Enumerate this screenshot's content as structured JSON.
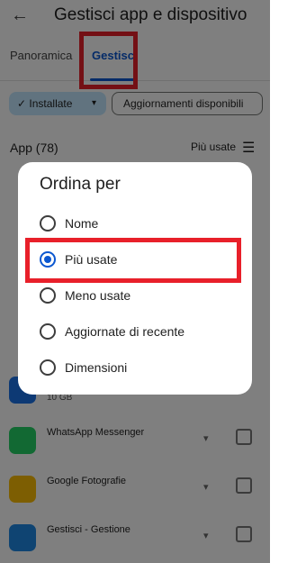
{
  "topbar": {
    "back_icon": "arrow-left-icon",
    "title": "Gestisci app e dispositivo"
  },
  "tabs": [
    {
      "label": "Panoramica",
      "active": false
    },
    {
      "label": "Gestisci",
      "active": true
    }
  ],
  "chips": {
    "installed": {
      "label": "Installate",
      "check_icon": "✓",
      "caret": "▾"
    },
    "updates": {
      "label": "Aggiornamenti disponibili"
    }
  },
  "list": {
    "count_label": "App (78)",
    "sort_label": "Più usate",
    "sort_icon": "sort-lines-icon"
  },
  "apps_background": [
    {
      "name": "",
      "size": "10 GB",
      "icon_color": "#1a73e8"
    },
    {
      "name": "WhatsApp Messenger",
      "size": "",
      "icon_color": "#25d366"
    },
    {
      "name": "Google Fotografie",
      "size": "",
      "icon_color": "#fbbc05"
    },
    {
      "name": "Gestisci - Gestione",
      "size": "",
      "icon_color": "#1e88e5"
    }
  ],
  "dialog": {
    "title": "Ordina per",
    "options": [
      {
        "label": "Nome",
        "selected": false
      },
      {
        "label": "Più usate",
        "selected": true
      },
      {
        "label": "Meno usate",
        "selected": false
      },
      {
        "label": "Aggiornate di recente",
        "selected": false
      },
      {
        "label": "Dimensioni",
        "selected": false
      }
    ]
  },
  "colors": {
    "accent": "#0b57d0",
    "highlight": "#e8202a",
    "chip_selected": "#c2e7ff"
  }
}
